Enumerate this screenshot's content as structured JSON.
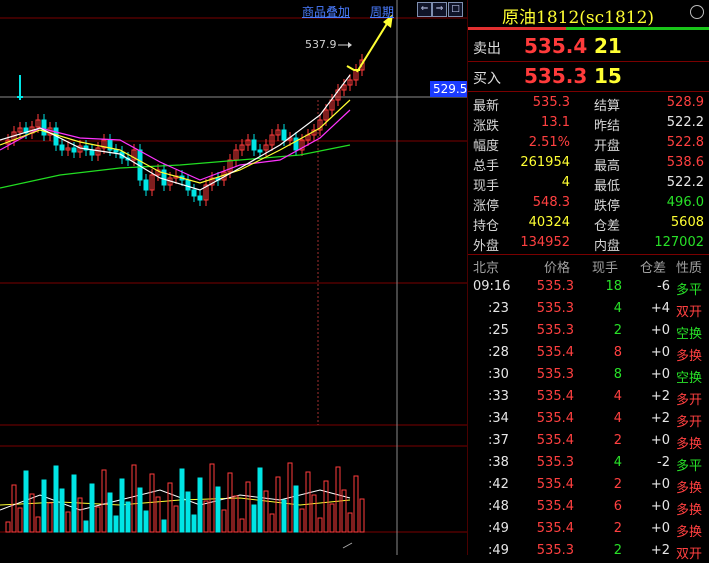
{
  "toolbar": {
    "overlay_label": "商品叠加",
    "period_label": "周期",
    "nav_left": "⇐",
    "nav_right": "⇒",
    "nav_close": "□"
  },
  "chart": {
    "price_tag": "529.5",
    "peak_label": "537.9"
  },
  "panel": {
    "title": "原油1812(sc1812)",
    "sell_label": "卖出",
    "sell_price": "535.4",
    "sell_qty": "21",
    "buy_label": "买入",
    "buy_price": "535.3",
    "buy_qty": "15",
    "stats": [
      {
        "l1": "最新",
        "v1": "535.3",
        "c1": "red",
        "l2": "结算",
        "v2": "528.9",
        "c2": "red"
      },
      {
        "l1": "涨跌",
        "v1": "13.1",
        "c1": "red",
        "l2": "昨结",
        "v2": "522.2",
        "c2": "white"
      },
      {
        "l1": "幅度",
        "v1": "2.51%",
        "c1": "red",
        "l2": "开盘",
        "v2": "522.8",
        "c2": "red"
      },
      {
        "l1": "总手",
        "v1": "261954",
        "c1": "yellow",
        "l2": "最高",
        "v2": "538.6",
        "c2": "red"
      },
      {
        "l1": "现手",
        "v1": "4",
        "c1": "yellow",
        "l2": "最低",
        "v2": "522.2",
        "c2": "white"
      },
      {
        "l1": "涨停",
        "v1": "548.3",
        "c1": "red",
        "l2": "跌停",
        "v2": "496.0",
        "c2": "green"
      },
      {
        "l1": "持仓",
        "v1": "40324",
        "c1": "yellow",
        "l2": "仓差",
        "v2": "5608",
        "c2": "yellow"
      },
      {
        "l1": "外盘",
        "v1": "134952",
        "c1": "red",
        "l2": "内盘",
        "v2": "127002",
        "c2": "green"
      }
    ],
    "tick_headers": {
      "city": "北京",
      "price": "价格",
      "qty": "现手",
      "diff": "仓差",
      "nature": "性质"
    },
    "ticks": [
      {
        "time": "09:16",
        "price": "535.3",
        "qty": "18",
        "qc": "green",
        "diff": "-6",
        "dc": "white",
        "nature": "多平",
        "nc": "green"
      },
      {
        "time": ":23",
        "price": "535.3",
        "qty": "4",
        "qc": "green",
        "diff": "+4",
        "dc": "white",
        "nature": "双开",
        "nc": "red"
      },
      {
        "time": ":25",
        "price": "535.3",
        "qty": "2",
        "qc": "green",
        "diff": "+0",
        "dc": "white",
        "nature": "空换",
        "nc": "green"
      },
      {
        "time": ":28",
        "price": "535.4",
        "qty": "8",
        "qc": "red",
        "diff": "+0",
        "dc": "white",
        "nature": "多换",
        "nc": "red"
      },
      {
        "time": ":30",
        "price": "535.3",
        "qty": "8",
        "qc": "green",
        "diff": "+0",
        "dc": "white",
        "nature": "空换",
        "nc": "green"
      },
      {
        "time": ":33",
        "price": "535.4",
        "qty": "4",
        "qc": "red",
        "diff": "+2",
        "dc": "white",
        "nature": "多开",
        "nc": "red"
      },
      {
        "time": ":34",
        "price": "535.4",
        "qty": "4",
        "qc": "red",
        "diff": "+2",
        "dc": "white",
        "nature": "多开",
        "nc": "red"
      },
      {
        "time": ":37",
        "price": "535.4",
        "qty": "2",
        "qc": "red",
        "diff": "+0",
        "dc": "white",
        "nature": "多换",
        "nc": "red"
      },
      {
        "time": ":38",
        "price": "535.3",
        "qty": "4",
        "qc": "green",
        "diff": "-2",
        "dc": "white",
        "nature": "多平",
        "nc": "green"
      },
      {
        "time": ":42",
        "price": "535.4",
        "qty": "2",
        "qc": "red",
        "diff": "+0",
        "dc": "white",
        "nature": "多换",
        "nc": "red"
      },
      {
        "time": ":48",
        "price": "535.4",
        "qty": "6",
        "qc": "red",
        "diff": "+0",
        "dc": "white",
        "nature": "多换",
        "nc": "red"
      },
      {
        "time": ":49",
        "price": "535.4",
        "qty": "2",
        "qc": "red",
        "diff": "+0",
        "dc": "white",
        "nature": "多换",
        "nc": "red"
      },
      {
        "time": ":49",
        "price": "535.3",
        "qty": "2",
        "qc": "green",
        "diff": "+2",
        "dc": "white",
        "nature": "双开",
        "nc": "red"
      }
    ]
  },
  "colors": {
    "up": "#ff3b3b",
    "down": "#00e5e5",
    "ma5": "#ffffff",
    "ma10": "#ffff33",
    "ma20": "#ff33ff",
    "ma60": "#22dd22",
    "grid": "#7a0000"
  }
}
